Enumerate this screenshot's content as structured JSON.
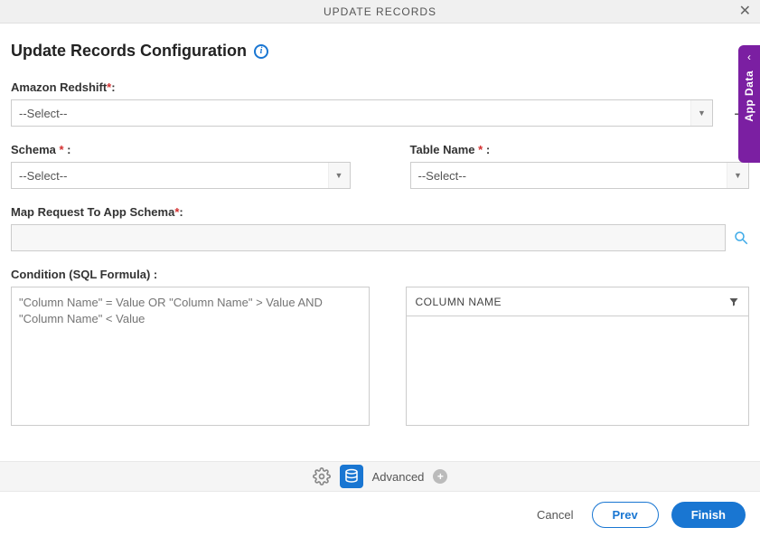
{
  "header": {
    "title": "UPDATE RECORDS"
  },
  "page": {
    "title": "Update Records Configuration"
  },
  "fields": {
    "connection": {
      "label": "Amazon Redshift",
      "value": "--Select--"
    },
    "schema": {
      "label": "Schema",
      "value": "--Select--"
    },
    "table": {
      "label": "Table Name",
      "value": "--Select--"
    },
    "map": {
      "label": "Map Request To App Schema",
      "value": ""
    },
    "condition": {
      "label": "Condition (SQL Formula) :",
      "placeholder": "\"Column Name\" = Value OR \"Column Name\" > Value AND \"Column Name\" < Value"
    },
    "column_header": "COLUMN NAME"
  },
  "bottom": {
    "advanced": "Advanced"
  },
  "footer": {
    "cancel": "Cancel",
    "prev": "Prev",
    "finish": "Finish"
  },
  "side": {
    "label": "App Data"
  }
}
